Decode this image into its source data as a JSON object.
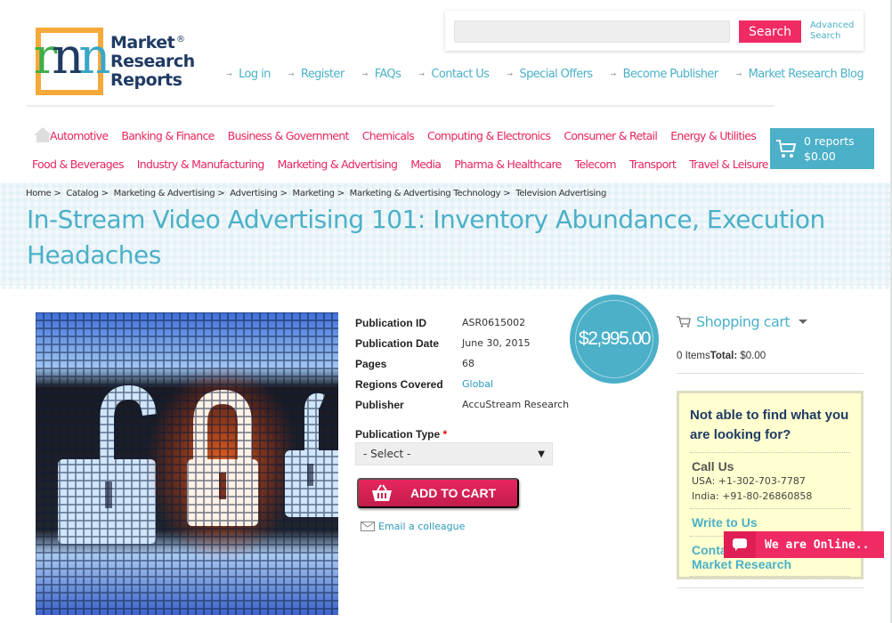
{
  "brand": {
    "logo_lines": [
      "Market",
      "Research",
      "Reports"
    ],
    "registered": "®",
    "logo_colors": {
      "frame": "#f7a93b",
      "navy": "#1f3b64",
      "green": "#3fae49",
      "teal": "#3aa6c7"
    }
  },
  "search": {
    "placeholder": "",
    "value": "",
    "button_label": "Search",
    "advanced_line1": "Advanced",
    "advanced_line2": "Search"
  },
  "top_links": [
    "Log in",
    "Register",
    "FAQs",
    "Contact Us",
    "Special Offers",
    "Become Publisher",
    "Market Research Blog"
  ],
  "categories": {
    "row1": [
      "Automotive",
      "Banking & Finance",
      "Business & Government",
      "Chemicals",
      "Computing & Electronics",
      "Consumer & Retail",
      "Energy & Utilities"
    ],
    "row2": [
      "Food & Beverages",
      "Industry & Manufacturing",
      "Marketing & Advertising",
      "Media",
      "Pharma & Healthcare",
      "Telecom",
      "Transport",
      "Travel & Leisure"
    ]
  },
  "header_cart": {
    "reports": "0 reports",
    "total": "$0.00"
  },
  "breadcrumb": [
    "Home",
    "Catalog",
    "Marketing & Advertising",
    "Advertising",
    "Marketing",
    "Marketing & Advertising Technology",
    "Television Advertising"
  ],
  "breadcrumb_sep": ">",
  "page_title": "In-Stream Video Advertising 101: Inventory Abundance, Execution Headaches",
  "product": {
    "image_icon": "padlock-screen-image",
    "details": [
      {
        "label": "Publication ID",
        "value": "ASR0615002",
        "link": false
      },
      {
        "label": "Publication Date",
        "value": "June 30, 2015",
        "link": false
      },
      {
        "label": "Pages",
        "value": "68",
        "link": false
      },
      {
        "label": "Regions Covered",
        "value": "Global",
        "link": true
      },
      {
        "label": "Publisher",
        "value": "AccuStream Research",
        "link": false
      }
    ],
    "price": "$2,995.00",
    "publication_type_label": "Publication Type",
    "required_mark": "*",
    "publication_type_selected": "- Select -",
    "add_to_cart_label": "ADD TO CART",
    "email_label": "Email a colleague"
  },
  "sidebar": {
    "cart_title": "Shopping cart",
    "items_text": "0 Items",
    "total_label": "Total:",
    "total_value": "$0.00",
    "help": {
      "title": "Not able to find what you are looking for?",
      "call_heading": "Call Us",
      "usa_phone": "USA: +1-302-703-7787",
      "india_phone": "India: +91-80-26860858",
      "write_heading": "Write to Us",
      "contact_heading_line1": "Contact",
      "contact_heading_line2": "Market Research"
    }
  },
  "chat_widget": {
    "label": "We are Online.."
  },
  "colors": {
    "accent_pink": "#e8265e",
    "accent_teal": "#4bb0c8",
    "search_button": "#f02b63"
  }
}
